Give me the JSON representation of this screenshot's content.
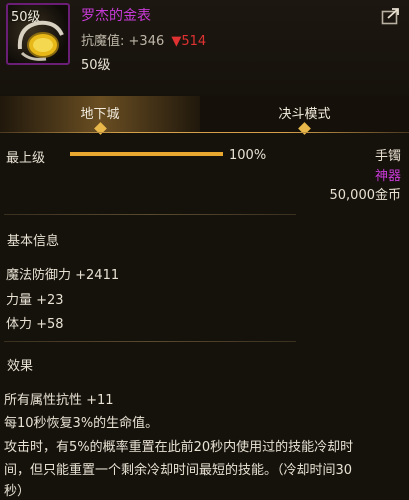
{
  "item": {
    "level_badge": "50级",
    "name": "罗杰的金表",
    "resist_label": "抗魔值:",
    "resist_value": "+346",
    "resist_delta": "▼514",
    "level_text": "50级"
  },
  "tabs": [
    {
      "label": "地下城"
    },
    {
      "label": "决斗模式"
    }
  ],
  "upgrade": {
    "label": "最上级",
    "percent_text": "100%",
    "progress_fraction": 1.0
  },
  "slot": {
    "type": "手镯",
    "rarity": "神器",
    "price": "50,000金币"
  },
  "basic_info": {
    "title": "基本信息",
    "stats": [
      "魔法防御力 +2411",
      "力量 +23",
      "体力 +58"
    ]
  },
  "effect": {
    "title": "效果",
    "lines": [
      "所有属性抗性 +11",
      "每10秒恢复3%的生命值。",
      "攻击时，有5%的概率重置在此前20秒内使用过的技能冷却时",
      "间，但只能重置一个剩余冷却时间最短的技能。（冷却时间30",
      "秒）"
    ]
  },
  "colors": {
    "rarity": "#c83ad8",
    "accent_gold": "#e8a830",
    "negative": "#e03232"
  },
  "icons": [
    "watch-icon",
    "share-icon"
  ]
}
